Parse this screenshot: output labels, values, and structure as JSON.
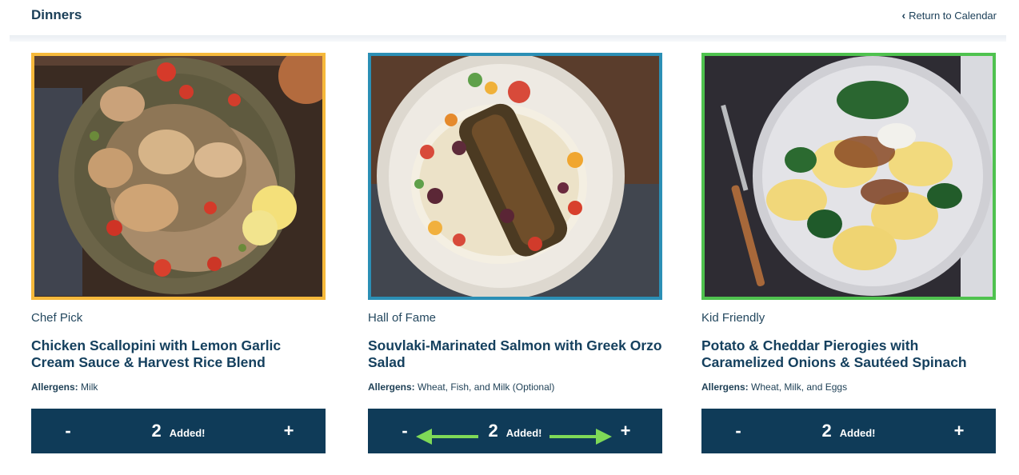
{
  "header": {
    "title": "Dinners",
    "return_label": "Return to Calendar"
  },
  "colors": {
    "chef_pick": "#f6b93b",
    "hall_of_fame": "#2b8fb5",
    "kid_friendly": "#4fc24f",
    "stepper": "#0f3b58",
    "arrow": "#7ed957"
  },
  "meals": [
    {
      "badge": "Chef Pick",
      "name": "Chicken Scallopini with Lemon Garlic Cream Sauce & Harvest Rice Blend",
      "allergens_label": "Allergens:",
      "allergens": "Milk",
      "minus": "-",
      "quantity": "2",
      "added": "Added!",
      "plus": "+"
    },
    {
      "badge": "Hall of Fame",
      "name": "Souvlaki-Marinated Salmon with Greek Orzo Salad",
      "allergens_label": "Allergens:",
      "allergens": "Wheat, Fish, and Milk (Optional)",
      "minus": "-",
      "quantity": "2",
      "added": "Added!",
      "plus": "+"
    },
    {
      "badge": "Kid Friendly",
      "name": "Potato & Cheddar Pierogies with Caramelized Onions & Sautéed Spinach",
      "allergens_label": "Allergens:",
      "allergens": "Wheat, Milk, and Eggs",
      "minus": "-",
      "quantity": "2",
      "added": "Added!",
      "plus": "+"
    }
  ]
}
